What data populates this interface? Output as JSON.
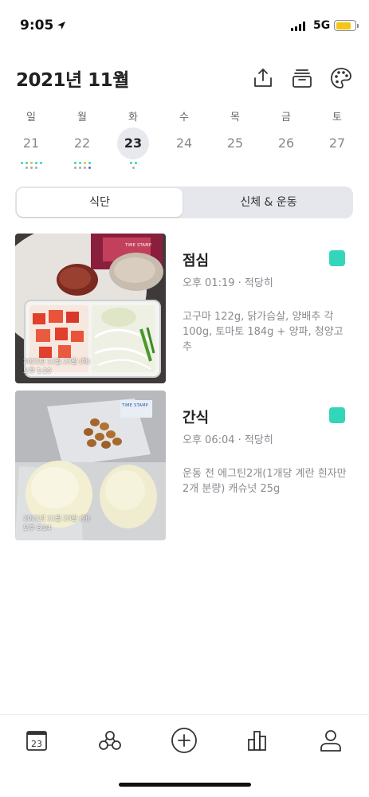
{
  "status_bar": {
    "time": "9:05",
    "network": "5G"
  },
  "header": {
    "month": "2021년 11월"
  },
  "calendar": {
    "weekdays": [
      "일",
      "월",
      "화",
      "수",
      "목",
      "금",
      "토"
    ],
    "dates": [
      "21",
      "22",
      "23",
      "24",
      "25",
      "26",
      "27"
    ],
    "selected_date": "23"
  },
  "segment": {
    "tabs": [
      "식단",
      "신체 & 운동"
    ],
    "active": "식단"
  },
  "meals": [
    {
      "title": "점심",
      "time": "오후 01:19",
      "amount": "적당히",
      "meta": "오후 01:19 · 적당히",
      "description": "고구마 122g, 닭가슴살, 양배추 각 100g, 토마토 184g + 양파, 청양고추",
      "photo_stamp_date": "2021년 11월 23일 (화)",
      "photo_stamp_time": "오후 1:19",
      "color": "#33d6b9"
    },
    {
      "title": "간식",
      "time": "오후 06:04",
      "amount": "적당히",
      "meta": "오후 06:04 · 적당히",
      "description": "운동 전 에그틴2개(1개당 계란 흰자만 2개 분량) 캐슈넛 25g",
      "photo_stamp_date": "2021년 11월 23일 (화)",
      "photo_stamp_time": "오후 6:04",
      "color": "#33d6b9"
    }
  ],
  "photo_tags": [
    "TIME STAMP",
    "TIME STAMP"
  ],
  "tabbar": {
    "calendar_badge": "23"
  },
  "colors": {
    "accent": "#33d6b9",
    "battery": "#f5c518"
  }
}
